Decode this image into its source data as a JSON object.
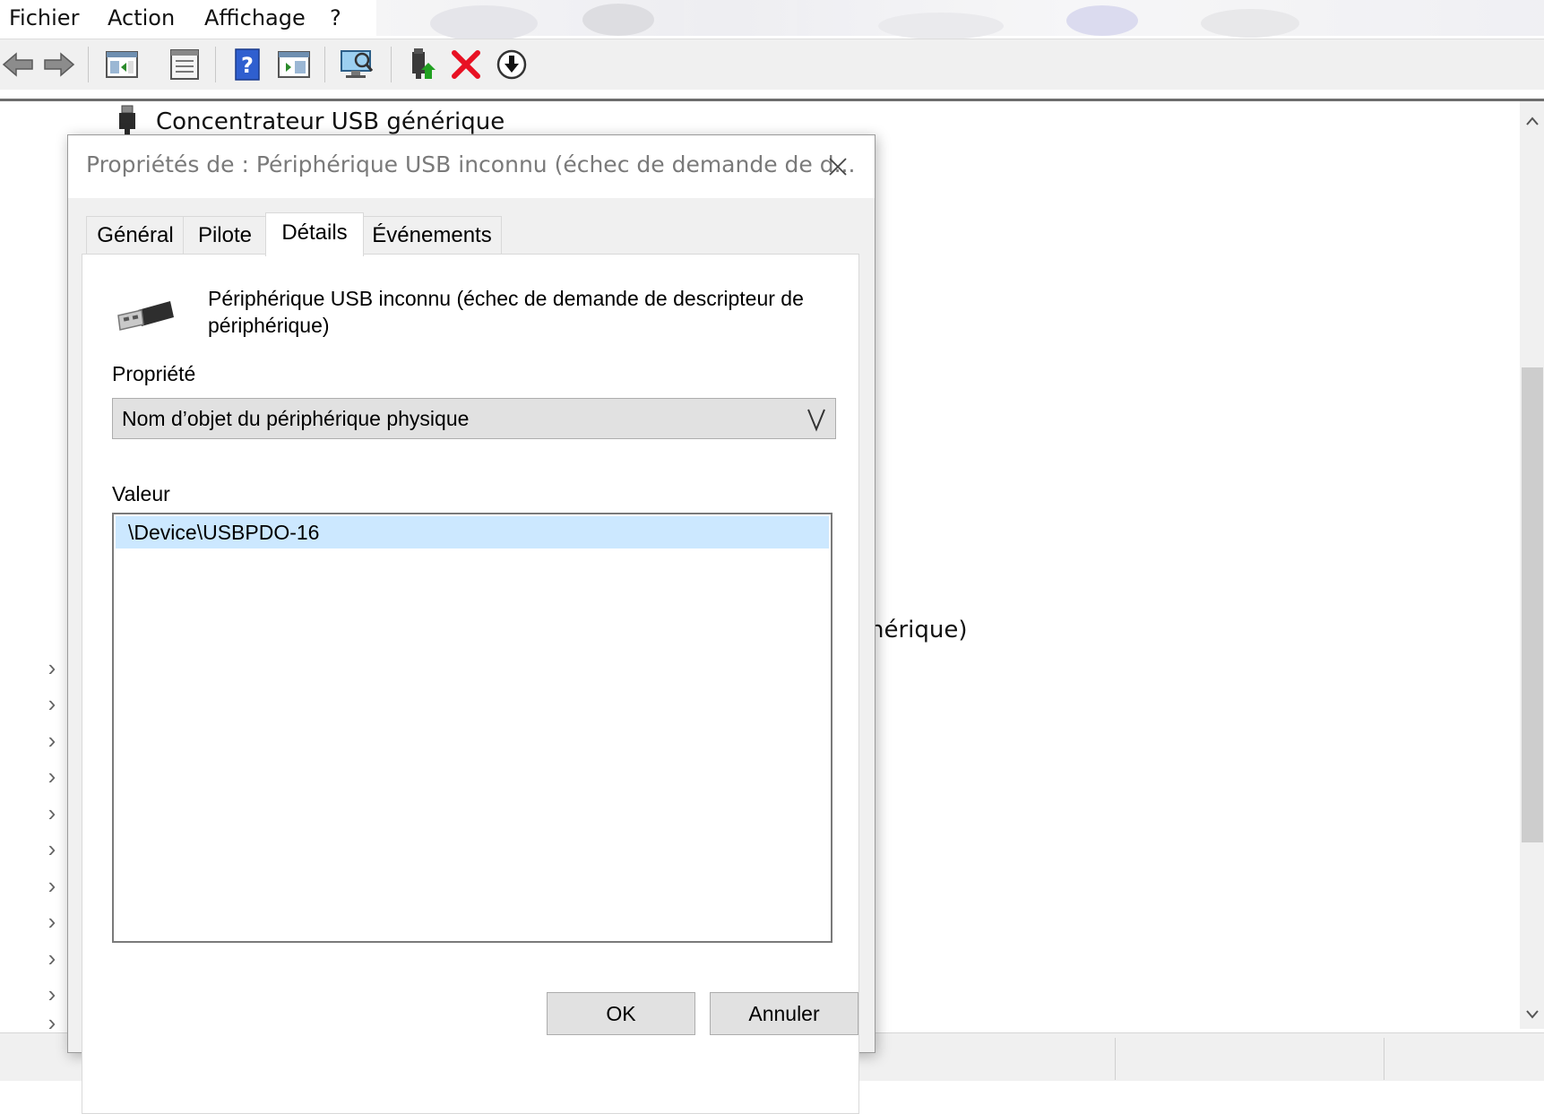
{
  "menu": {
    "items": [
      "Fichier",
      "Action",
      "Affichage",
      "?"
    ]
  },
  "toolbar": {
    "buttons": [
      {
        "icon": "back-arrow-icon"
      },
      {
        "icon": "forward-arrow-icon"
      },
      {
        "icon": "show-hide-console-tree-icon"
      },
      {
        "icon": "properties-icon"
      },
      {
        "icon": "help-icon"
      },
      {
        "icon": "show-action-pane-icon"
      },
      {
        "icon": "scan-hardware-icon"
      },
      {
        "icon": "update-driver-icon"
      },
      {
        "icon": "uninstall-device-icon"
      },
      {
        "icon": "disable-device-icon"
      }
    ]
  },
  "tree": {
    "top_item": "Concentrateur USB générique",
    "partial_item": "nérique)",
    "collapsed_rows": 11
  },
  "dialog": {
    "title": "Propriétés de : Périphérique USB inconnu (échec de demande de d...",
    "tabs": [
      "Général",
      "Pilote",
      "Détails",
      "Événements"
    ],
    "active_tab": "Détails",
    "device_name": "Périphérique USB inconnu (échec de demande de descripteur de périphérique)",
    "property_label": "Propriété",
    "property_value": "Nom d’objet du périphérique physique",
    "value_label": "Valeur",
    "values": [
      "\\Device\\USBPDO-16"
    ],
    "ok_label": "OK",
    "cancel_label": "Annuler"
  },
  "colors": {
    "selection": "#cce8ff",
    "uninstall_red": "#e81123",
    "dialog_bg": "#f0f0f0"
  }
}
